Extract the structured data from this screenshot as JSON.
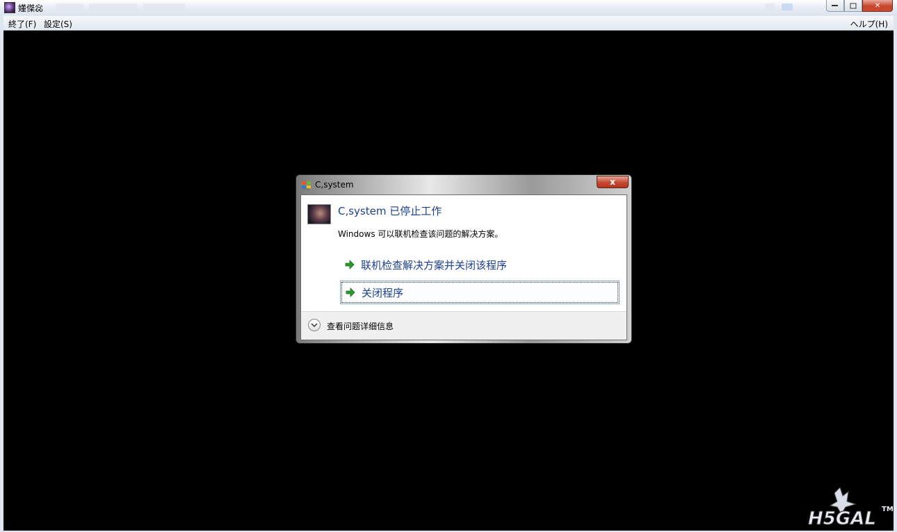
{
  "window": {
    "title": "嬞傑惢",
    "caption": {
      "minimize": "",
      "maximize": "",
      "close": "✕"
    }
  },
  "menubar": {
    "exit": "終了(F)",
    "settings": "設定(S)",
    "help": "ヘルプ(H)"
  },
  "dialog": {
    "title": "C,system",
    "close_label": "x",
    "main_message": "C,system 已停止工作",
    "sub_message": "Windows 可以联机检查该问题的解决方案。",
    "options": [
      {
        "label": "联机检查解决方案并关闭该程序"
      },
      {
        "label": "关闭程序"
      }
    ],
    "details_label": "查看问题详细信息"
  },
  "watermark": {
    "text": "H5GAL",
    "tm": "TM"
  },
  "colors": {
    "accent": "#1b3f8f",
    "arrow": "#2b9a2b",
    "background": "#000000"
  },
  "icons": [
    "app-icon",
    "windows-shield-icon",
    "program-icon",
    "green-arrow-icon",
    "chevron-down-icon"
  ]
}
